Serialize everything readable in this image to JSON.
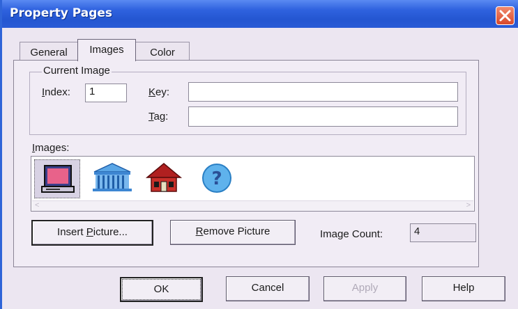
{
  "window": {
    "title": "Property Pages"
  },
  "tabs": [
    {
      "label": "General"
    },
    {
      "label": "Images"
    },
    {
      "label": "Color"
    }
  ],
  "current_image": {
    "legend": "Current Image",
    "index_label_u": "I",
    "index_label_rest": "ndex:",
    "index_value": "1",
    "key_label_u": "K",
    "key_label_rest": "ey:",
    "key_value": "",
    "tag_label_u": "T",
    "tag_label_rest": "ag:",
    "tag_value": ""
  },
  "images": {
    "label_u": "I",
    "label_rest": "mages:",
    "items": [
      {
        "icon": "computer-icon"
      },
      {
        "icon": "bank-building-icon"
      },
      {
        "icon": "house-icon"
      },
      {
        "icon": "help-question-icon"
      }
    ]
  },
  "actions": {
    "insert_pre": "Insert ",
    "insert_u": "P",
    "insert_rest": "icture...",
    "remove_u": "R",
    "remove_rest": "emove Picture",
    "image_count_label": "Image Count:",
    "image_count_value": "4"
  },
  "dialog_buttons": {
    "ok": "OK",
    "cancel": "Cancel",
    "apply": "Apply",
    "help": "Help"
  },
  "colors": {
    "titlebar": "#2f62df",
    "dialog_bg": "#ece6f1",
    "close_button": "#d9482a"
  }
}
